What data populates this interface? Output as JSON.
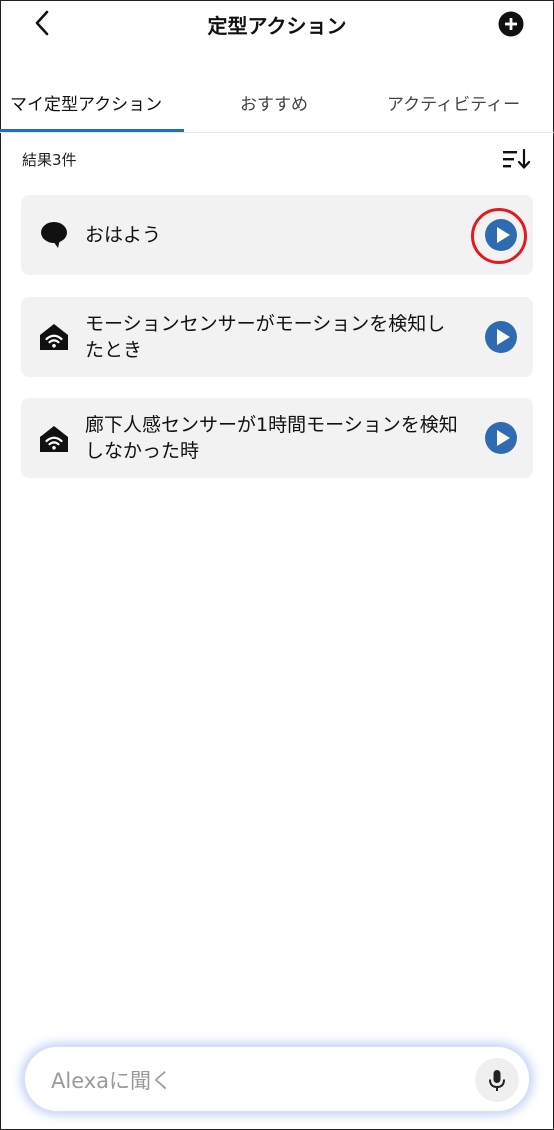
{
  "header": {
    "title": "定型アクション"
  },
  "tabs": [
    {
      "label": "マイ定型アクション",
      "active": true
    },
    {
      "label": "おすすめ",
      "active": false
    },
    {
      "label": "アクティビティー",
      "active": false
    }
  ],
  "results_label": "結果3件",
  "routines": [
    {
      "name": "おはよう",
      "icon": "speech-bubble-icon"
    },
    {
      "name": "モーションセンサーがモーションを検知したとき",
      "icon": "smart-home-sensor-icon"
    },
    {
      "name": "廊下人感センサーが1時間モーションを検知しなかった時",
      "icon": "smart-home-sensor-icon"
    }
  ],
  "ask_bar": {
    "placeholder": "Alexaに聞く"
  },
  "colors": {
    "accent": "#1e6fbf",
    "play": "#2f6bb0",
    "highlight": "#e01b24",
    "card_bg": "#f2f2f2"
  }
}
